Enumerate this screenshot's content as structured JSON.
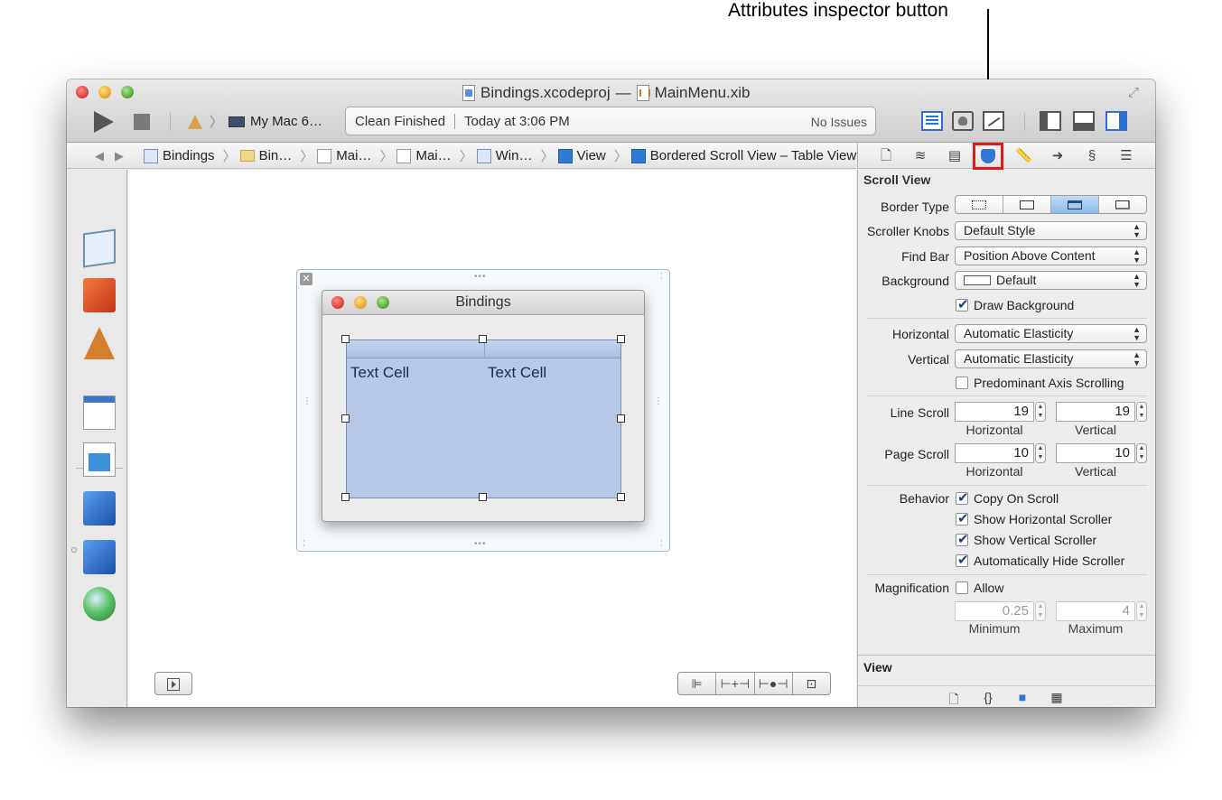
{
  "callout": {
    "label": "Attributes inspector button"
  },
  "window": {
    "title_project": "Bindings.xcodeproj",
    "title_dash": "—",
    "title_file": "MainMenu.xib"
  },
  "toolbar": {
    "scheme": "My Mac 6…",
    "activity_status": "Clean Finished",
    "activity_time": "Today at 3:06 PM",
    "issues": "No Issues"
  },
  "jumpbar": {
    "crumbs": [
      "Bindings",
      "Bin…",
      "Mai…",
      "Mai…",
      "Win…",
      "View",
      "Bordered Scroll View – Table View"
    ]
  },
  "canvas": {
    "window_title": "Bindings",
    "cell_1": "Text Cell",
    "cell_2": "Text Cell"
  },
  "inspector": {
    "section_title": "Scroll View",
    "border_type_label": "Border Type",
    "scroller_knobs_label": "Scroller Knobs",
    "scroller_knobs_value": "Default Style",
    "find_bar_label": "Find Bar",
    "find_bar_value": "Position Above Content",
    "background_label": "Background",
    "background_value": "Default",
    "draw_background": "Draw Background",
    "horizontal_label": "Horizontal",
    "horizontal_value": "Automatic Elasticity",
    "vertical_label": "Vertical",
    "vertical_value": "Automatic Elasticity",
    "predominant": "Predominant Axis Scrolling",
    "line_scroll_label": "Line Scroll",
    "line_scroll_h": "19",
    "line_scroll_v": "19",
    "page_scroll_label": "Page Scroll",
    "page_scroll_h": "10",
    "page_scroll_v": "10",
    "sub_horizontal": "Horizontal",
    "sub_vertical": "Vertical",
    "behavior_label": "Behavior",
    "copy_on_scroll": "Copy On Scroll",
    "show_horizontal": "Show Horizontal Scroller",
    "show_vertical": "Show Vertical Scroller",
    "auto_hide": "Automatically Hide Scroller",
    "magnification_label": "Magnification",
    "allow": "Allow",
    "mag_min": "0.25",
    "mag_max": "4",
    "minimum": "Minimum",
    "maximum": "Maximum",
    "bottom_title": "View"
  },
  "colors": {
    "highlight_frame": "#e8161a",
    "selection_blue": "#b6c8e6"
  }
}
